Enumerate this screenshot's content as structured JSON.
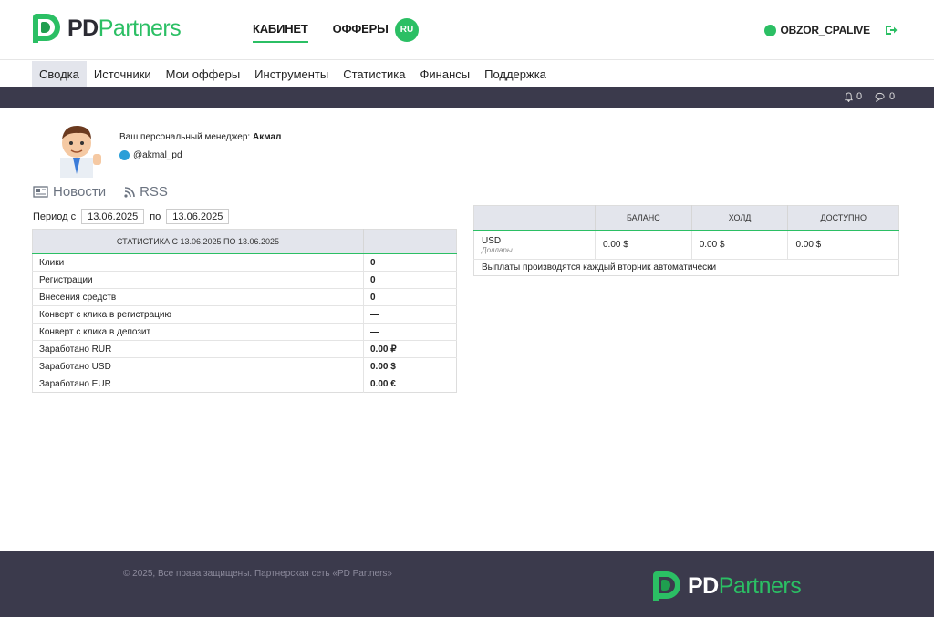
{
  "brand": {
    "name_bold": "PD",
    "name_light": "Partners",
    "accent": "#2bbf64",
    "dark": "#3b3a4c"
  },
  "topnav": {
    "cabinet": "КАБИНЕТ",
    "offers": "ОФФЕРЫ",
    "lang": "RU"
  },
  "user": {
    "name": "OBZOR_CPALIVE",
    "status_color": "#2bbf64"
  },
  "subnav": [
    "Сводка",
    "Источники",
    "Мои офферы",
    "Инструменты",
    "Статистика",
    "Финансы",
    "Поддержка"
  ],
  "notifications": {
    "bell_count": "0",
    "chat_count": "0"
  },
  "manager": {
    "label": "Ваш персональный менеджер:",
    "name": "Акмал",
    "telegram": "@akmal_pd"
  },
  "news": {
    "news_label": "Новости",
    "rss_label": "RSS"
  },
  "period": {
    "from_label": "Период с",
    "from": "13.06.2025",
    "to_label": "по",
    "to": "13.06.2025"
  },
  "stats": {
    "header": "Статистика с 13.06.2025 по 13.06.2025",
    "rows": [
      {
        "label": "Клики",
        "value": "0"
      },
      {
        "label": "Регистрации",
        "value": "0"
      },
      {
        "label": "Внесения средств",
        "value": "0"
      },
      {
        "label": "Конверт с клика в регистрацию",
        "value": "—"
      },
      {
        "label": "Конверт с клика в депозит",
        "value": "—"
      },
      {
        "label": "Заработано RUR",
        "value": "0.00 ₽"
      },
      {
        "label": "Заработано USD",
        "value": "0.00 $"
      },
      {
        "label": "Заработано EUR",
        "value": "0.00 €"
      }
    ]
  },
  "balance": {
    "headers": [
      "Баланс",
      "Холд",
      "Доступно"
    ],
    "currency": "USD",
    "currency_sub": "Доллары",
    "values": [
      "0.00 $",
      "0.00 $",
      "0.00 $"
    ],
    "note": "Выплаты производятся каждый вторник автоматически"
  },
  "footer": {
    "copyright": "© 2025, Все права защищены. Партнерская сеть «PD Partners»"
  }
}
